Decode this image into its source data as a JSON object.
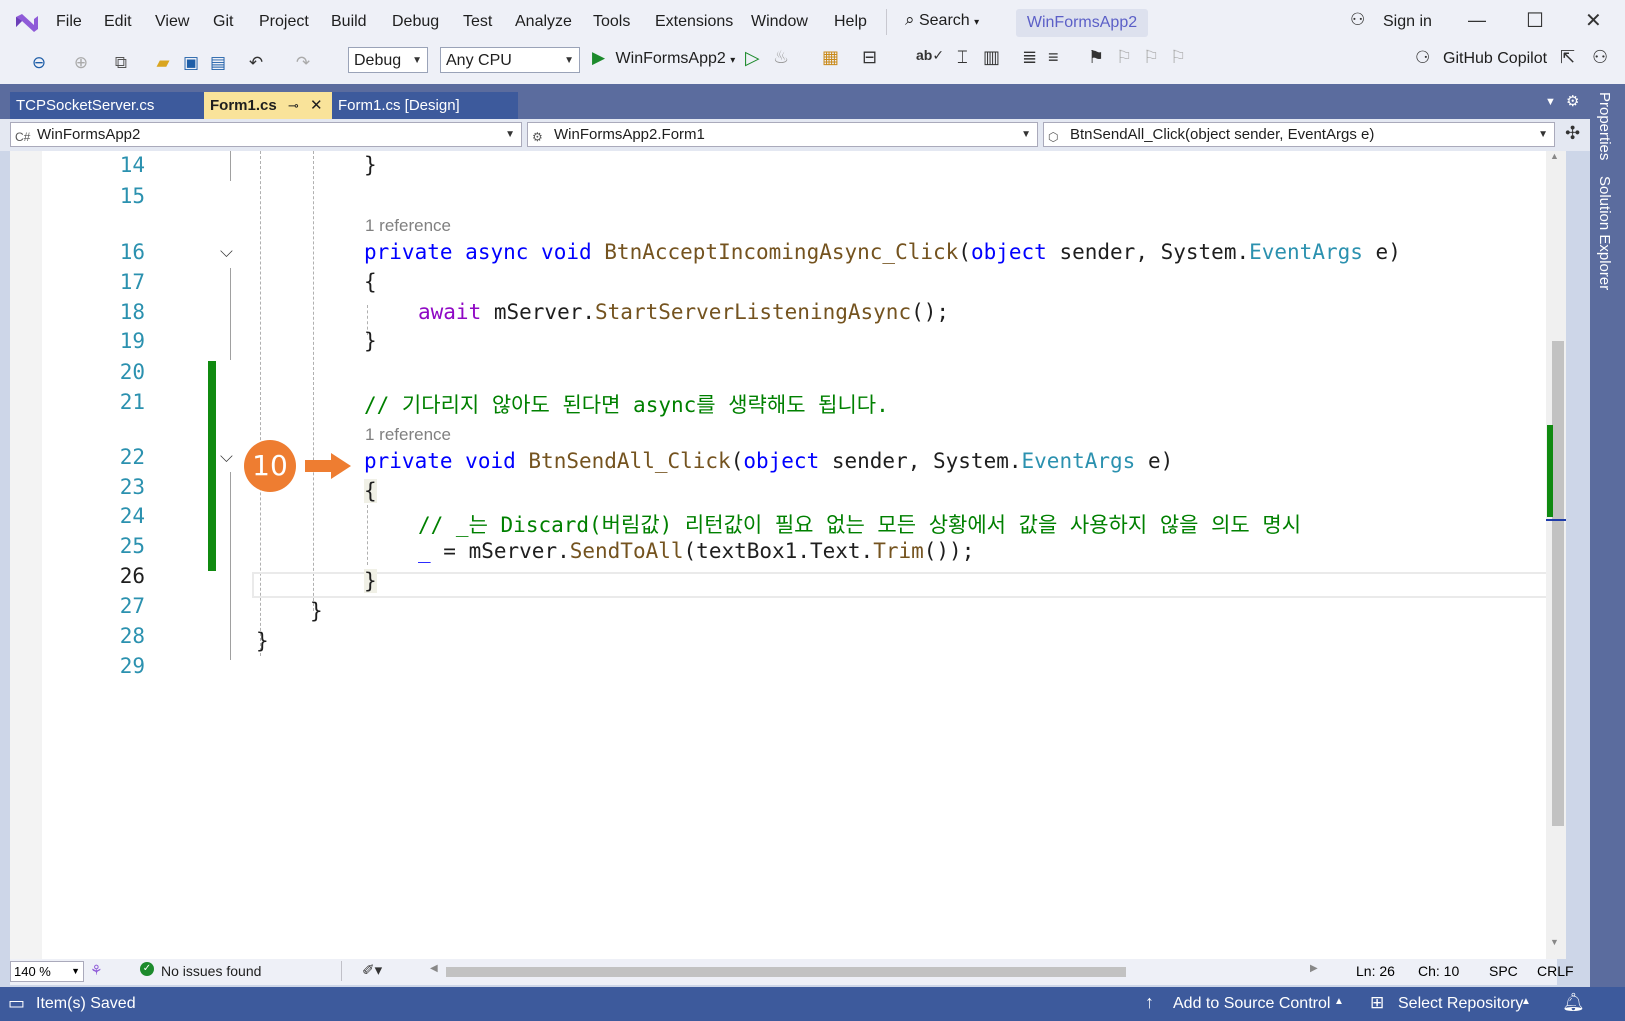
{
  "menu": [
    "File",
    "Edit",
    "View",
    "Git",
    "Project",
    "Build",
    "Debug",
    "Test",
    "Analyze",
    "Tools",
    "Extensions",
    "Window",
    "Help"
  ],
  "search_label": "Search",
  "solution_title": "WinFormsApp2",
  "sign_in": "Sign in",
  "toolbar": {
    "config": "Debug",
    "platform": "Any CPU",
    "run_target": "WinFormsApp2",
    "copilot": "GitHub Copilot"
  },
  "tabs": [
    {
      "label": "TCPSocketServer.cs"
    },
    {
      "label": "Form1.cs"
    },
    {
      "label": "Form1.cs [Design]"
    }
  ],
  "nav": {
    "project": "WinFormsApp2",
    "class": "WinFormsApp2.Form1",
    "member": "BtnSendAll_Click(object sender, EventArgs e)"
  },
  "line_numbers": [
    "14",
    "15",
    "16",
    "17",
    "18",
    "19",
    "20",
    "21",
    "22",
    "23",
    "24",
    "25",
    "26",
    "27",
    "28",
    "29"
  ],
  "code": {
    "l14": "}",
    "ref1": "1 reference",
    "l16_kw1": "private",
    "l16_kw2": "async",
    "l16_kw3": "void",
    "l16_name": "BtnAcceptIncomingAsync_Click",
    "l16_p1": "(",
    "l16_kw4": "object",
    "l16_p2": " sender, System.",
    "l16_ty": "EventArgs",
    "l16_p3": " e)",
    "l17": "{",
    "l18_kw": "await",
    "l18_p1": " mServer.",
    "l18_m": "StartServerListeningAsync",
    "l18_p2": "();",
    "l19": "}",
    "l21_comment": "// 기다리지 않아도 된다면 async를 생략해도 됩니다.",
    "ref2": "1 reference",
    "l22_kw1": "private",
    "l22_kw2": "void",
    "l22_name": "BtnSendAll_Click",
    "l22_p1": "(",
    "l22_kw3": "object",
    "l22_p2": " sender, System.",
    "l22_ty": "EventArgs",
    "l22_p3": " e)",
    "l23": "{",
    "l24_comment": "// _는 Discard(버림값) 리턴값이 필요 없는 모든 상황에서 값을 사용하지 않을 의도 명시",
    "l25_p0": "_",
    "l25_p1": " = mServer.",
    "l25_m": "SendToAll",
    "l25_p2": "(textBox1.Text.",
    "l25_m2": "Trim",
    "l25_p3": "());",
    "l26": "}",
    "l27": "}",
    "l28": "}"
  },
  "annotation_badge": "10",
  "editor_status": {
    "zoom": "140 %",
    "issues": "No issues found",
    "ln": "Ln: 26",
    "ch": "Ch: 10",
    "spc": "SPC",
    "crlf": "CRLF"
  },
  "status": {
    "saved": "Item(s) Saved",
    "source_control": "Add to Source Control",
    "repository": "Select Repository"
  },
  "right_rail": [
    "Properties",
    "Solution Explorer"
  ],
  "colors": {
    "accent": "#5b6c9e",
    "status": "#3d5a9c",
    "change_bar": "#108a10",
    "badge": "#ee7d31"
  }
}
